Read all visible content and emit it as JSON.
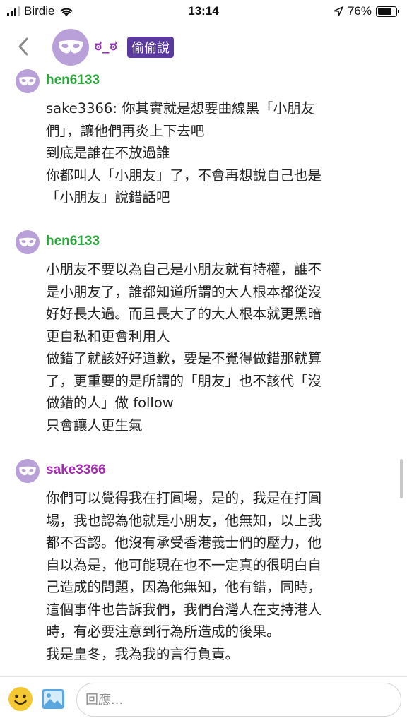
{
  "status_bar": {
    "carrier": "Birdie",
    "time": "13:14",
    "battery": "76%",
    "battery_level": 0.76
  },
  "header": {
    "handle": "ಠ_ಠ",
    "badge": "偷偷說"
  },
  "comments": [
    {
      "author": "hen6133",
      "author_color": "#2aa63a",
      "lines": [
        "sake3366: 你其實就是想要曲線黑「小朋友",
        "們」，讓他們再炎上下去吧",
        "到底是誰在不放過誰",
        "你都叫人「小朋友」了，不會再想說自己也是",
        "「小朋友」說錯話吧"
      ]
    },
    {
      "author": "hen6133",
      "author_color": "#2aa63a",
      "lines": [
        "小朋友不要以為自己是小朋友就有特權，誰不",
        "是小朋友了，誰都知道所謂的大人根本都從沒",
        "好好長大過。而且長大了的大人根本就更黑暗",
        "更自私和更會利用人",
        "做錯了就該好好道歉，要是不覺得做錯那就算",
        "了，更重要的是所謂的「朋友」也不該代「沒",
        "做錯的人」做 follow",
        "只會讓人更生氣"
      ]
    },
    {
      "author": "sake3366",
      "author_color": "#a62ab2",
      "lines": [
        "你們可以覺得我在打圓場，是的，我是在打圓",
        "場，我也認為他就是小朋友，他無知，以上我",
        "都不否認。他沒有承受香港義士們的壓力，他",
        "自以為是，他可能現在也不一定真的很明白自",
        "己造成的問題，因為他無知，他有錯，同時，",
        "這個事件也告訴我們，我們台灣人在支持港人",
        "時，有必要注意到行為所造成的後果。",
        "我是皇冬，我為我的言行負責。"
      ]
    }
  ],
  "reply": {
    "placeholder": "回應..."
  },
  "icons": {
    "avatar": "mask-icon",
    "back": "chevron-left-icon",
    "emoji": "smiley-icon",
    "image": "image-icon"
  }
}
